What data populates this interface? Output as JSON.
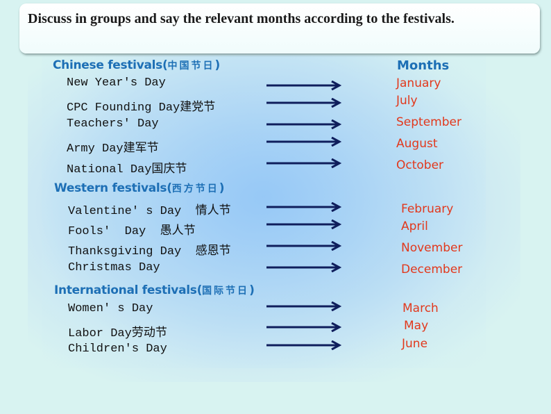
{
  "title": "Discuss in groups and say the relevant months according to the festivals.",
  "months_header": "Months",
  "colors": {
    "heading": "#1d6fb5",
    "month": "#e2381c",
    "arrow": "#0f1e5c",
    "festival_text": "#111111"
  },
  "sections": [
    {
      "heading": "Chinese festivals(",
      "heading_cn": "中国节日",
      "heading_end": ")",
      "items": [
        {
          "festival": "New Year's Day",
          "month": "January"
        },
        {
          "festival": "CPC Founding Day建党节",
          "month": "July"
        },
        {
          "festival": "Teachers' Day",
          "month": "September"
        },
        {
          "festival": "Army Day建军节",
          "month": "August"
        },
        {
          "festival": "National Day国庆节",
          "month": "October"
        }
      ]
    },
    {
      "heading": "Western festivals(",
      "heading_cn": "西方节日",
      "heading_end": ")",
      "items": [
        {
          "festival": "Valentine' s Day  情人节",
          "month": "February"
        },
        {
          "festival": "Fools'  Day  愚人节",
          "month": "April"
        },
        {
          "festival": "Thanksgiving Day  感恩节",
          "month": "November"
        },
        {
          "festival": "Christmas Day",
          "month": "December"
        }
      ]
    },
    {
      "heading": "International festivals(",
      "heading_cn": "国际节日",
      "heading_end": ")",
      "items": [
        {
          "festival": "Women' s Day",
          "month": "March"
        },
        {
          "festival": "Labor Day劳动节",
          "month": "May"
        },
        {
          "festival": "Children's Day",
          "month": "June"
        }
      ]
    }
  ],
  "arrow_icon": "right-arrow-icon"
}
